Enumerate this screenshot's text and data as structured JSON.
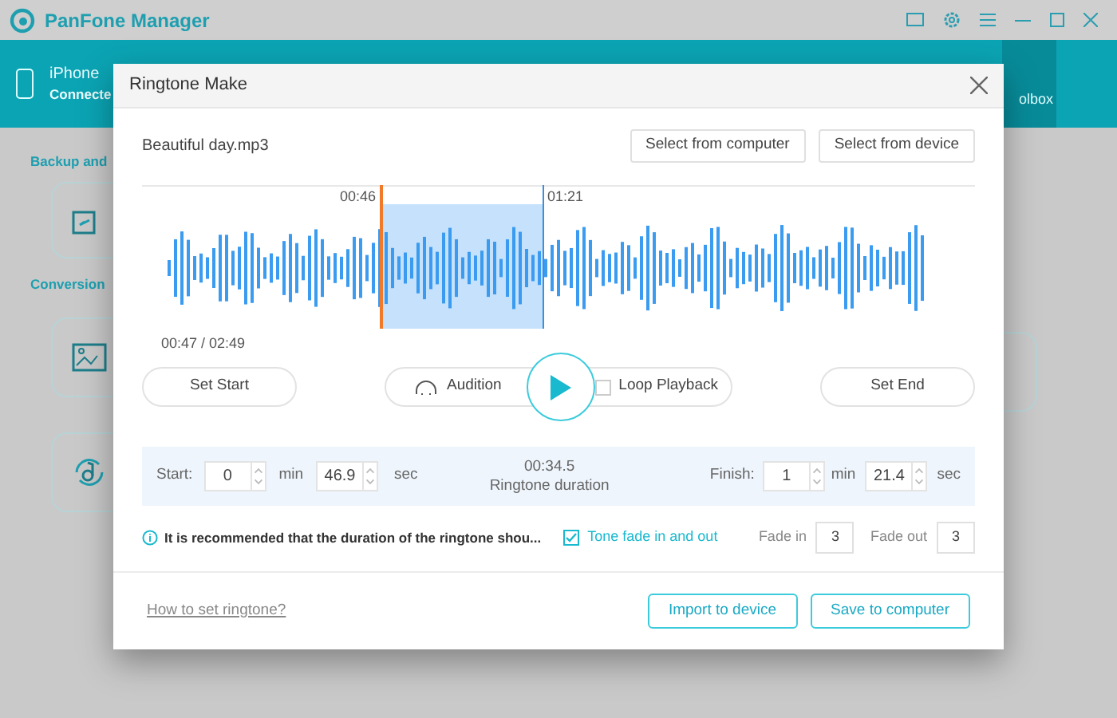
{
  "app": {
    "title": "PanFone Manager"
  },
  "device": {
    "name": "iPhone",
    "status": "Connecte"
  },
  "nav": [
    {
      "label": "olbox",
      "selected": true
    }
  ],
  "sections": [
    {
      "title": "Backup and"
    },
    {
      "title": "Conversion"
    }
  ],
  "dialog": {
    "title": "Ringtone Make",
    "file": "Beautiful day.mp3",
    "select_buttons": [
      "Select from computer",
      "Select from device"
    ],
    "markers": {
      "start": "00:46",
      "end": "01:21"
    },
    "position": "00:47 / 02:49",
    "set_start": "Set Start",
    "audition": "Audition",
    "loop": {
      "label": "Loop Playback",
      "checked": false
    },
    "set_end": "Set End",
    "start": {
      "label": "Start:",
      "min": "0",
      "min_unit": "min",
      "sec": "46.9",
      "sec_unit": "sec"
    },
    "duration": {
      "value": "00:34.5",
      "label": "Ringtone duration"
    },
    "finish": {
      "label": "Finish:",
      "min": "1",
      "min_unit": "min",
      "sec": "21.4",
      "sec_unit": "sec"
    },
    "tip": "It is recommended that the duration of the ringtone shou...",
    "fade": {
      "label": "Tone fade in and out",
      "checked": true
    },
    "fade_in": {
      "label": "Fade in",
      "value": "3"
    },
    "fade_out": {
      "label": "Fade out",
      "value": "3"
    },
    "help_link": "How to set ringtone?",
    "actions": [
      "Import to device",
      "Save to computer"
    ]
  }
}
